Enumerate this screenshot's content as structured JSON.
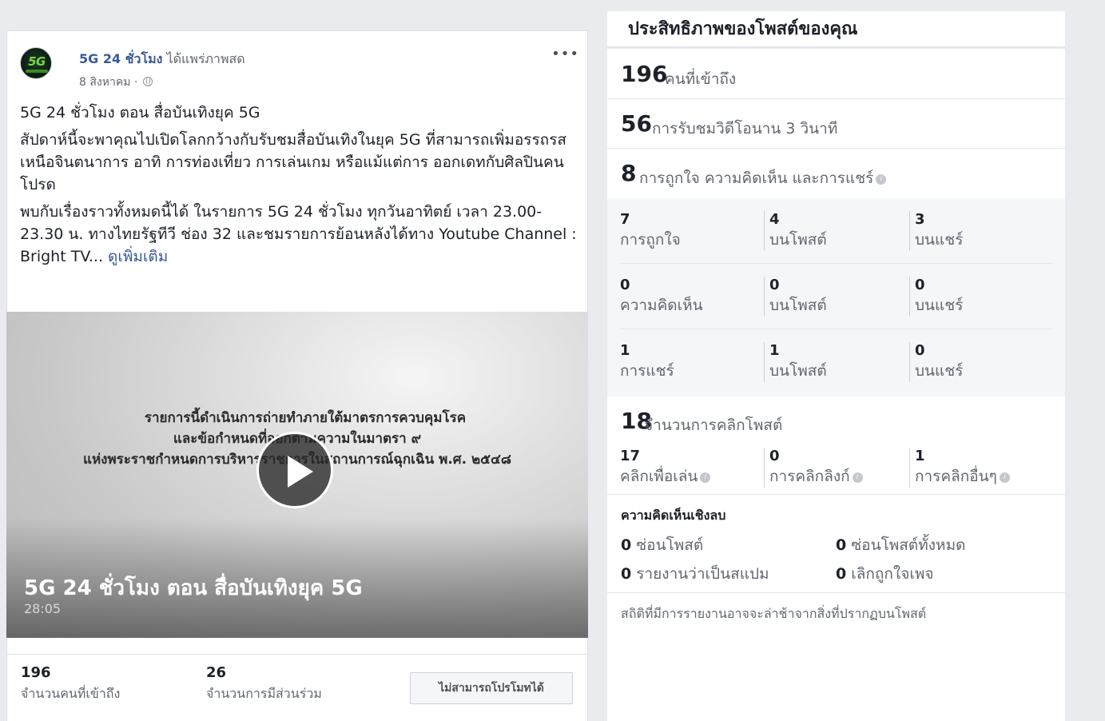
{
  "post": {
    "page_name": "5G 24 ชั่วโมง",
    "action": "ได้แพร่ภาพสด",
    "date": "8 สิงหาคม ·",
    "more_label": "•••",
    "avatar_text": "5G",
    "headline": "5G 24 ชั่วโมง ตอน สื่อบันเทิงยุค 5G",
    "body_1": "สัปดาห์นี้จะพาคุณไปเปิดโลกกว้างกับรับชมสื่อบันเทิงในยุค 5G ที่สามารถเพิ่มอรรถรสเหนือจินตนาการ อาทิ การท่องเที่ยว การเล่นเกม หรือแม้แต่การ ออกเดทกับศิลปินคนโปรด",
    "body_2": "พบกับเรื่องราวทั้งหมดนี้ได้ ในรายการ 5G 24 ชั่วโมง ทุกวันอาทิตย์ เวลา 23.00-23.30 น. ทางไทยรัฐทีวี ช่อง 32 และชมรายการย้อนหลังได้ทาง Youtube Channel : Bright TV... ",
    "see_more": "ดูเพิ่มเติม",
    "video": {
      "caption_line_1": "รายการนี้ดำเนินการถ่ายทำภายใต้มาตรการควบคุมโรค",
      "caption_line_2": "และข้อกำหนดที่ออกตามความในมาตรา ๙",
      "caption_line_3": "แห่งพระราชกำหนดการบริหารราชการในสถานการณ์ฉุกเฉิน พ.ศ. ๒๕๔๘",
      "title": "5G 24 ชั่วโมง ตอน สื่อบันเทิงยุค 5G",
      "duration": "28:05"
    },
    "stats": {
      "reach_value": "196",
      "reach_label": "จำนวนคนที่เข้าถึง",
      "engagement_value": "26",
      "engagement_label": "จำนวนการมีส่วนร่วม",
      "promote_label": "ไม่สามารถโปรโมทได้"
    }
  },
  "performance": {
    "title": "ประสิทธิภาพของโพสต์ของคุณ",
    "reach": {
      "value": "196",
      "label": "คนที่เข้าถึง"
    },
    "views": {
      "value": "56",
      "label": "การรับชมวิดีโอนาน 3 วินาที"
    },
    "engagement": {
      "value": "8",
      "label": "การถูกใจ ความคิดเห็น และการแชร์"
    },
    "grid": [
      {
        "total": "7",
        "total_label": "การถูกใจ",
        "on_post": "4",
        "on_post_label": "บนโพสต์",
        "on_shares": "3",
        "on_shares_label": "บนแชร์"
      },
      {
        "total": "0",
        "total_label": "ความคิดเห็น",
        "on_post": "0",
        "on_post_label": "บนโพสต์",
        "on_shares": "0",
        "on_shares_label": "บนแชร์"
      },
      {
        "total": "1",
        "total_label": "การแชร์",
        "on_post": "1",
        "on_post_label": "บนโพสต์",
        "on_shares": "0",
        "on_shares_label": "บนแชร์"
      }
    ],
    "clicks": {
      "value": "18",
      "label": "จำนวนการคลิกโพสต์"
    },
    "click_breakdown": [
      {
        "value": "17",
        "label": "คลิกเพื่อเล่น"
      },
      {
        "value": "0",
        "label": "การคลิกลิงก์"
      },
      {
        "value": "1",
        "label": "การคลิกอื่นๆ"
      }
    ],
    "negative": {
      "title": "ความคิดเห็นเชิงลบ",
      "hide_post_value": "0",
      "hide_post_label": "ซ่อนโพสต์",
      "hide_all_value": "0",
      "hide_all_label": "ซ่อนโพสต์ทั้งหมด",
      "spam_value": "0",
      "spam_label": "รายงานว่าเป็นสแปม",
      "unlike_value": "0",
      "unlike_label": "เลิกถูกใจเพจ"
    },
    "footnote": "สถิติที่มีการรายงานอาจจะล่าช้าจากสิ่งที่ปรากฏบนโพสต์"
  },
  "colors": {
    "link": "#385898",
    "background": "#e9ebee",
    "muted_text": "#616770"
  }
}
